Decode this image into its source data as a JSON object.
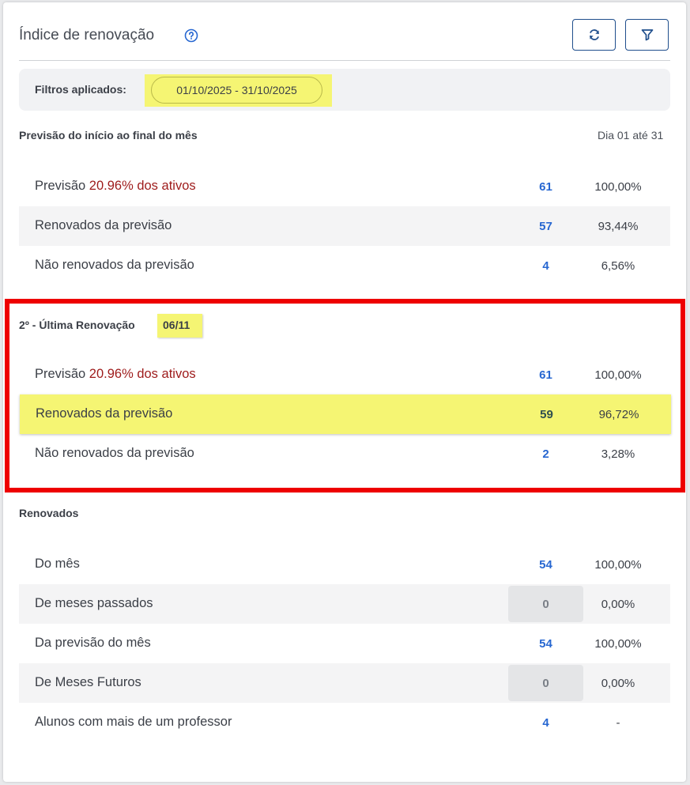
{
  "header": {
    "title": "Índice de renovação",
    "help_icon": "question-circle-icon",
    "refresh_icon": "refresh-icon",
    "filter_icon": "funnel-icon"
  },
  "filters": {
    "label": "Filtros aplicados:",
    "chip": "01/10/2025 - 31/10/2025"
  },
  "forecast": {
    "title": "Previsão do início ao final do mês",
    "range": "Dia 01 até 31",
    "rows": [
      {
        "label": "Previsão ",
        "label_highlight": "20.96% dos ativos",
        "value": "61",
        "percent": "100,00%"
      },
      {
        "label": "Renovados da previsão",
        "value": "57",
        "percent": "93,44%"
      },
      {
        "label": "Não renovados da previsão",
        "value": "4",
        "percent": "6,56%"
      }
    ]
  },
  "last_renewal": {
    "title": "2º - Última Renovação",
    "date": "06/11",
    "rows": [
      {
        "label": "Previsão ",
        "label_highlight": "20.96% dos ativos",
        "value": "61",
        "percent": "100,00%"
      },
      {
        "label": "Renovados da previsão",
        "value": "59",
        "percent": "96,72%"
      },
      {
        "label": "Não renovados da previsão",
        "value": "2",
        "percent": "3,28%"
      }
    ]
  },
  "renewed": {
    "title": "Renovados",
    "rows": [
      {
        "label": "Do mês",
        "value": "54",
        "percent": "100,00%"
      },
      {
        "label": "De meses passados",
        "value": "0",
        "percent": "0,00%"
      },
      {
        "label": "Da previsão do mês",
        "value": "54",
        "percent": "100,00%"
      },
      {
        "label": "De Meses Futuros",
        "value": "0",
        "percent": "0,00%"
      },
      {
        "label": "Alunos com mais de um professor",
        "value": "4",
        "percent": "-"
      }
    ]
  },
  "colors": {
    "accent_blue": "#2767d1",
    "highlight_yellow": "#f5f573",
    "frame_red": "#ee0000",
    "forecast_red": "#9e1b1b"
  }
}
